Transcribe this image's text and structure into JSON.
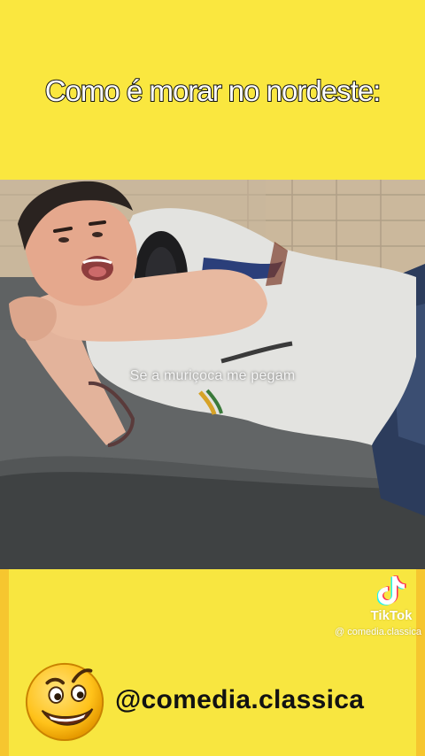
{
  "header": {
    "title": "Como é morar no nordeste:"
  },
  "video": {
    "subtitle": "Se a muriçoca me pegam"
  },
  "watermark": {
    "brand": "TikTok",
    "user": "@ comedia.classica",
    "icon": "tiktok-note-icon"
  },
  "footer": {
    "handle": "@comedia.classica",
    "icon": "smirking-face-emoji"
  },
  "colors": {
    "background": "#f8e640",
    "stroke": "#111111",
    "text_light": "#ffffff"
  }
}
